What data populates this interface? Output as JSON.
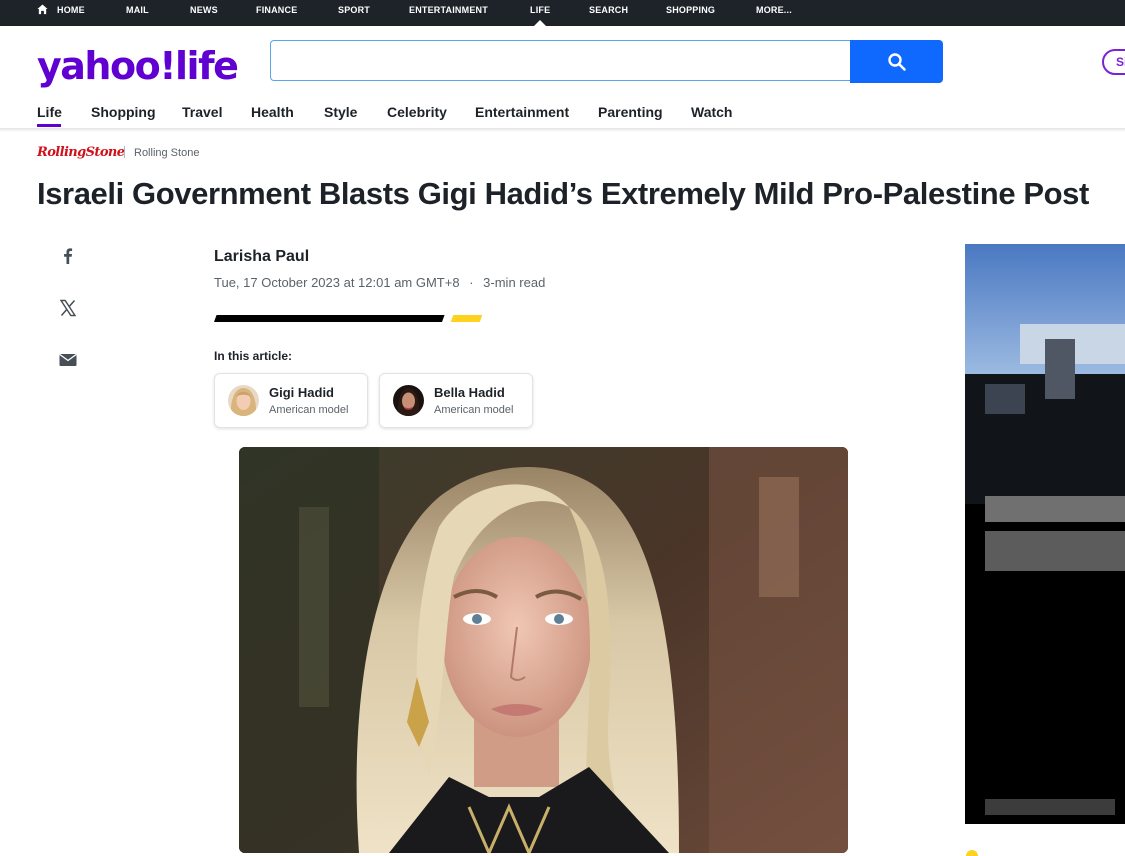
{
  "top_nav": {
    "items": [
      {
        "label": "HOME"
      },
      {
        "label": "MAIL"
      },
      {
        "label": "NEWS"
      },
      {
        "label": "FINANCE"
      },
      {
        "label": "SPORT"
      },
      {
        "label": "ENTERTAINMENT"
      },
      {
        "label": "LIFE"
      },
      {
        "label": "SEARCH"
      },
      {
        "label": "SHOPPING"
      },
      {
        "label": "MORE..."
      }
    ],
    "active": "LIFE"
  },
  "header": {
    "logo_yahoo": "yahoo",
    "logo_bang": "!",
    "logo_section": "life",
    "search": {
      "value": "",
      "placeholder": ""
    },
    "signin_label": "Si"
  },
  "sub_nav": {
    "items": [
      {
        "label": "Life"
      },
      {
        "label": "Shopping"
      },
      {
        "label": "Travel"
      },
      {
        "label": "Health"
      },
      {
        "label": "Style"
      },
      {
        "label": "Celebrity"
      },
      {
        "label": "Entertainment"
      },
      {
        "label": "Parenting"
      },
      {
        "label": "Watch"
      }
    ],
    "active": "Life"
  },
  "article": {
    "source_logo": "RollingStone",
    "source_name": "Rolling Stone",
    "headline": "Israeli Government Blasts Gigi Hadid’s Extremely Mild Pro-Palestine Post",
    "author": "Larisha Paul",
    "date": "Tue, 17 October 2023 at 12:01 am GMT+8",
    "separator": "·",
    "read_time": "3-min read",
    "in_this_article": "In this article:",
    "people": [
      {
        "name": "Gigi Hadid",
        "role": "American model"
      },
      {
        "name": "Bella Hadid",
        "role": "American model"
      }
    ]
  },
  "share": {
    "icons": [
      "facebook-icon",
      "x-icon",
      "mail-icon"
    ]
  },
  "colors": {
    "brand_purple": "#6001d2",
    "search_blue": "#0f69ff",
    "top_nav_bg": "#1e232a",
    "accent_yellow": "#ffd21f",
    "rolling_stone_red": "#d0111b"
  }
}
